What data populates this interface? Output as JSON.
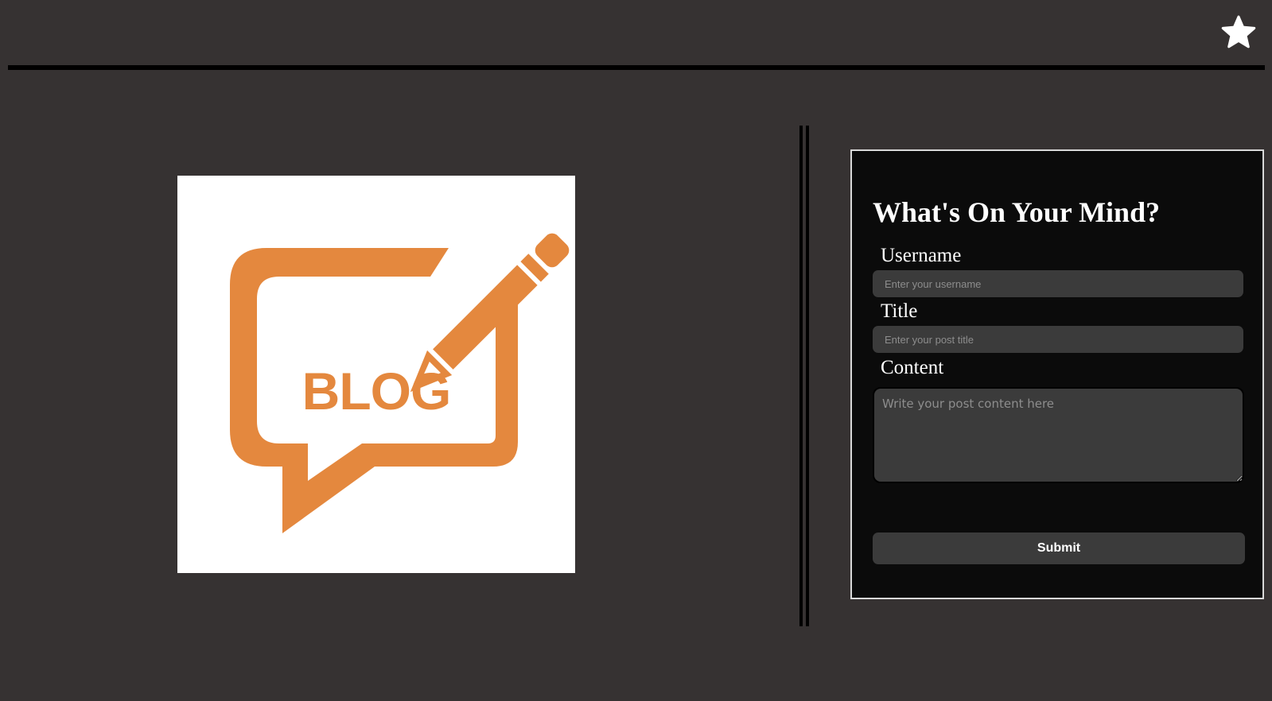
{
  "header": {
    "favorite_icon": "star-icon"
  },
  "logo": {
    "text": "BLOG",
    "color": "#E4883E",
    "background": "#FFFFFF"
  },
  "form": {
    "title": "What's On Your Mind?",
    "username": {
      "label": "Username",
      "placeholder": "Enter your username",
      "value": ""
    },
    "post_title": {
      "label": "Title",
      "placeholder": "Enter your post title",
      "value": ""
    },
    "content": {
      "label": "Content",
      "placeholder": "Write your post content here",
      "value": ""
    },
    "submit_label": "Submit"
  },
  "colors": {
    "page_background": "#363232",
    "panel_background": "#0B0B0B",
    "input_background": "#3B3B3B",
    "accent": "#E4883E"
  }
}
